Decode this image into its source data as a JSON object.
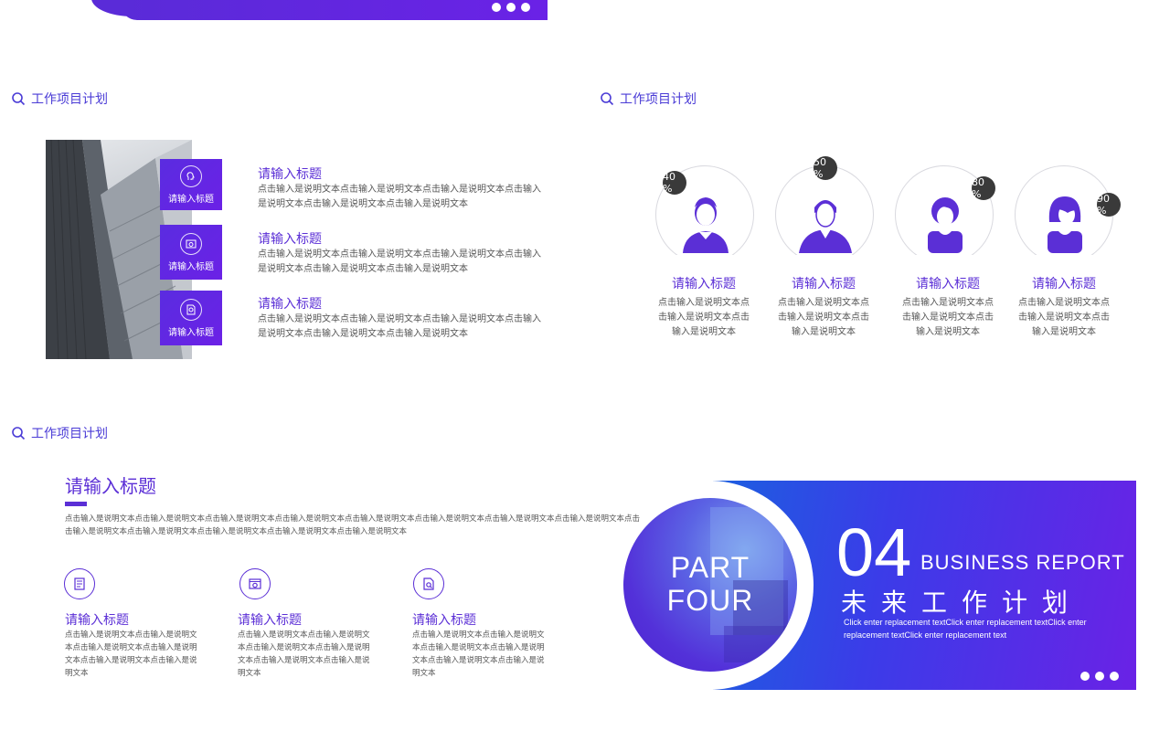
{
  "colors": {
    "accent": "#5b2fd6",
    "blue": "#1c5fe0",
    "dark_badge": "#3a3a3a"
  },
  "section_label": "工作项目计划",
  "slide1": {
    "tiles": [
      {
        "icon": "head-gear-icon",
        "label": "请输入标题"
      },
      {
        "icon": "settings-window-icon",
        "label": "请输入标题"
      },
      {
        "icon": "document-search-icon",
        "label": "请输入标题"
      }
    ],
    "items": [
      {
        "title": "请输入标题",
        "line1": "点击输入是说明文本点击输入是说明文本点击输入是说明文本点击输入",
        "line2": "是说明文本点击输入是说明文本点击输入是说明文本"
      },
      {
        "title": "请输入标题",
        "line1": "点击输入是说明文本点击输入是说明文本点击输入是说明文本点击输入",
        "line2": "是说明文本点击输入是说明文本点击输入是说明文本"
      },
      {
        "title": "请输入标题",
        "line1": "点击输入是说明文本点击输入是说明文本点击输入是说明文本点击输入",
        "line2": "是说明文本点击输入是说明文本点击输入是说明文本"
      }
    ]
  },
  "slide2": {
    "people": [
      {
        "icon": "man-suit-icon",
        "percent": "40 %",
        "title": "请输入标题",
        "lines": [
          "点击输入是说明文本点",
          "击输入是说明文本点击",
          "输入是说明文本"
        ]
      },
      {
        "icon": "man-casual-icon",
        "percent": "50 %",
        "title": "请输入标题",
        "lines": [
          "点击输入是说明文本点",
          "击输入是说明文本点击",
          "输入是说明文本"
        ]
      },
      {
        "icon": "woman-short-hair-icon",
        "percent": "80 %",
        "title": "请输入标题",
        "lines": [
          "点击输入是说明文本点",
          "击输入是说明文本点击",
          "输入是说明文本"
        ]
      },
      {
        "icon": "woman-bob-hair-icon",
        "percent": "90 %",
        "title": "请输入标题",
        "lines": [
          "点击输入是说明文本点",
          "击输入是说明文本点击",
          "输入是说明文本"
        ]
      }
    ]
  },
  "slide3": {
    "title": "请输入标题",
    "para1": "点击输入是说明文本点击输入是说明文本点击输入是说明文本点击输入是说明文本点击输入是说明文本点击输入是说明文本点击输入是说明文本点击输入是说明文本点击",
    "para2": "击输入是说明文本点击输入是说明文本点击输入是说明文本点击输入是说明文本点击输入是说明文本",
    "cards": [
      {
        "icon": "notebook-icon",
        "title": "请输入标题",
        "lines": [
          "点击输入是说明文本点击输入是说明文",
          "本点击输入是说明文本点击输入是说明",
          "文本点击输入是说明文本点击输入是说",
          "明文本"
        ]
      },
      {
        "icon": "settings-window-icon",
        "title": "请输入标题",
        "lines": [
          "点击输入是说明文本点击输入是说明文",
          "本点击输入是说明文本点击输入是说明",
          "文本点击输入是说明文本点击输入是说",
          "明文本"
        ]
      },
      {
        "icon": "document-search-icon",
        "title": "请输入标题",
        "lines": [
          "点击输入是说明文本点击输入是说明文",
          "本点击输入是说明文本点击输入是说明",
          "文本点击输入是说明文本点击输入是说",
          "明文本"
        ]
      }
    ]
  },
  "slide4": {
    "part1": "PART",
    "part2": "FOUR",
    "number": "04",
    "english_title": "BUSINESS REPORT",
    "chinese_title": "未来工作计划",
    "sub_line1": "Click enter replacement textClick enter replacement textClick enter",
    "sub_line2": "replacement textClick enter replacement text"
  }
}
